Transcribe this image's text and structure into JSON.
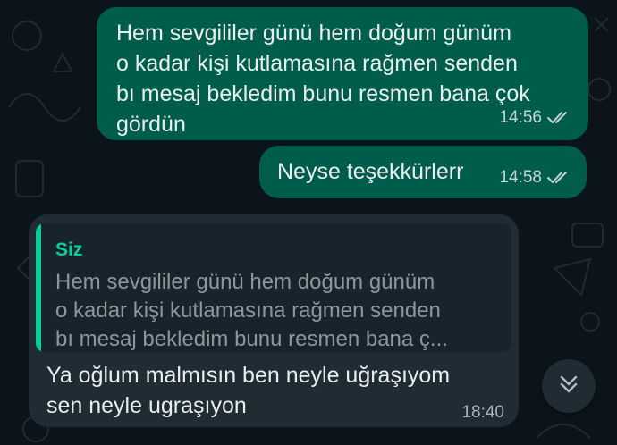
{
  "messages": [
    {
      "direction": "outgoing",
      "text": "Hem sevgililer günü hem doğum günüm\no kadar kişi kutlamasına rağmen senden\nbı mesaj bekledim bunu resmen bana çok\ngördün",
      "time": "14:56",
      "status": "read"
    },
    {
      "direction": "outgoing",
      "text": "Neyse teşekkürlerr",
      "time": "14:58",
      "status": "read"
    },
    {
      "direction": "incoming",
      "quote": {
        "author": "Siz",
        "text": "Hem sevgililer günü hem doğum günüm\no kadar kişi kutlamasına rağmen senden\nbı mesaj bekledim bunu resmen bana ç..."
      },
      "text": "Ya oğlum malmısın ben neyle uğraşıyom\nsen neyle ugraşıyon",
      "time": "18:40"
    }
  ],
  "scroll_button": {
    "icon": "double-chevron-down-icon"
  },
  "colors": {
    "background": "#0b141a",
    "outgoing_bubble": "#005c4b",
    "incoming_bubble": "#1f2c34",
    "quote_accent": "#06cf9c",
    "text": "#e9edef"
  }
}
